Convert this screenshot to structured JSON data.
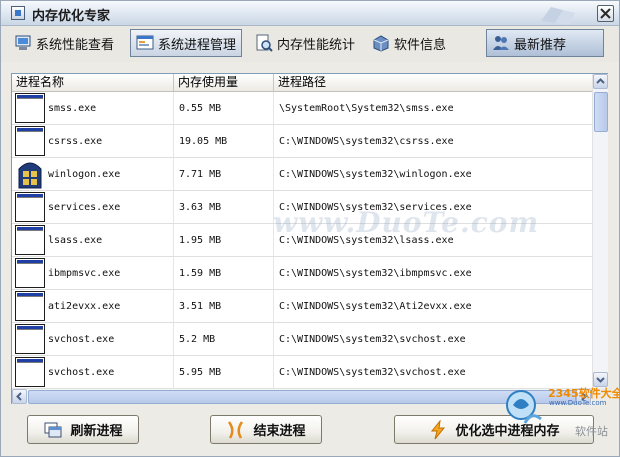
{
  "window": {
    "title": "内存优化专家"
  },
  "toolbar": {
    "items": [
      {
        "label": "系统性能查看",
        "icon": "monitor-icon"
      },
      {
        "label": "系统进程管理",
        "icon": "window-list-icon",
        "active": true
      },
      {
        "label": "内存性能统计",
        "icon": "doc-magnifier-icon"
      },
      {
        "label": "软件信息",
        "icon": "info-box-icon"
      },
      {
        "label": "最新推荐",
        "icon": "people-icon"
      }
    ]
  },
  "table": {
    "columns": [
      "进程名称",
      "内存使用量",
      "进程路径"
    ],
    "rows": [
      {
        "name": "smss.exe",
        "mem": "0.55 MB",
        "path": "\\SystemRoot\\System32\\smss.exe"
      },
      {
        "name": "csrss.exe",
        "mem": "19.05 MB",
        "path": "C:\\WINDOWS\\system32\\csrss.exe"
      },
      {
        "name": "winlogon.exe",
        "mem": "7.71 MB",
        "path": "C:\\WINDOWS\\system32\\winlogon.exe"
      },
      {
        "name": "services.exe",
        "mem": "3.63 MB",
        "path": "C:\\WINDOWS\\system32\\services.exe"
      },
      {
        "name": "lsass.exe",
        "mem": "1.95 MB",
        "path": "C:\\WINDOWS\\system32\\lsass.exe"
      },
      {
        "name": "ibmpmsvc.exe",
        "mem": "1.59 MB",
        "path": "C:\\WINDOWS\\system32\\ibmpmsvc.exe"
      },
      {
        "name": "ati2evxx.exe",
        "mem": "3.51 MB",
        "path": "C:\\WINDOWS\\system32\\Ati2evxx.exe"
      },
      {
        "name": "svchost.exe",
        "mem": "5.2 MB",
        "path": "C:\\WINDOWS\\system32\\svchost.exe"
      },
      {
        "name": "svchost.exe",
        "mem": "5.95 MB",
        "path": "C:\\WINDOWS\\system32\\svchost.exe"
      }
    ]
  },
  "buttons": {
    "refresh": "刷新进程",
    "end": "结束进程",
    "optimize": "优化选中进程内存"
  },
  "watermark": {
    "domain": "www.DuoTe.com",
    "brand": "2345软件大全",
    "brand_url": "www.DuoTe.com",
    "brand_cn": "软件站"
  },
  "colors": {
    "accent": "#3a77c9",
    "list_border": "#7f9db9",
    "brand": "#f08a00"
  }
}
